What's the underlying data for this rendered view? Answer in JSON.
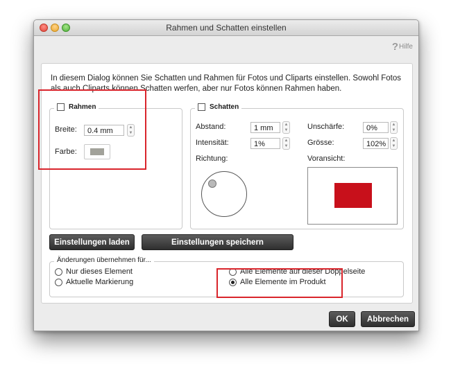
{
  "window": {
    "title": "Rahmen und Schatten einstellen"
  },
  "help": {
    "icon": "question-mark-icon",
    "label": "Hilfe"
  },
  "intro": "In diesem Dialog können Sie Schatten und Rahmen für Fotos und Cliparts einstellen. Sowohl Fotos als auch Cliparts können Schatten werfen, aber nur Fotos können Rahmen haben.",
  "rahmen": {
    "title": "Rahmen",
    "checked": false,
    "breite_label": "Breite:",
    "breite_value": "0.4 mm",
    "farbe_label": "Farbe:",
    "farbe_color": "#a2a29a"
  },
  "schatten": {
    "title": "Schatten",
    "checked": false,
    "abstand_label": "Abstand:",
    "abstand_value": "1 mm",
    "intensitaet_label": "Intensität:",
    "intensitaet_value": "1%",
    "unschaerfe_label": "Unschärfe:",
    "unschaerfe_value": "0%",
    "groesse_label": "Grösse:",
    "groesse_value": "102%",
    "richtung_label": "Richtung:",
    "voransicht_label": "Voransicht:",
    "preview_color": "#c8101b"
  },
  "buttons": {
    "laden": "Einstellungen laden",
    "speichern": "Einstellungen speichern",
    "ok": "OK",
    "abbrechen": "Abbrechen"
  },
  "apply": {
    "title": "Änderungen übernehmen für...",
    "options": [
      {
        "label": "Nur dieses Element",
        "selected": false
      },
      {
        "label": "Aktuelle Markierung",
        "selected": false
      },
      {
        "label": "Alle Elemente auf dieser Doppelseite",
        "selected": false
      },
      {
        "label": "Alle Elemente im Produkt",
        "selected": true
      }
    ]
  },
  "annotation_color": "#d9242b"
}
